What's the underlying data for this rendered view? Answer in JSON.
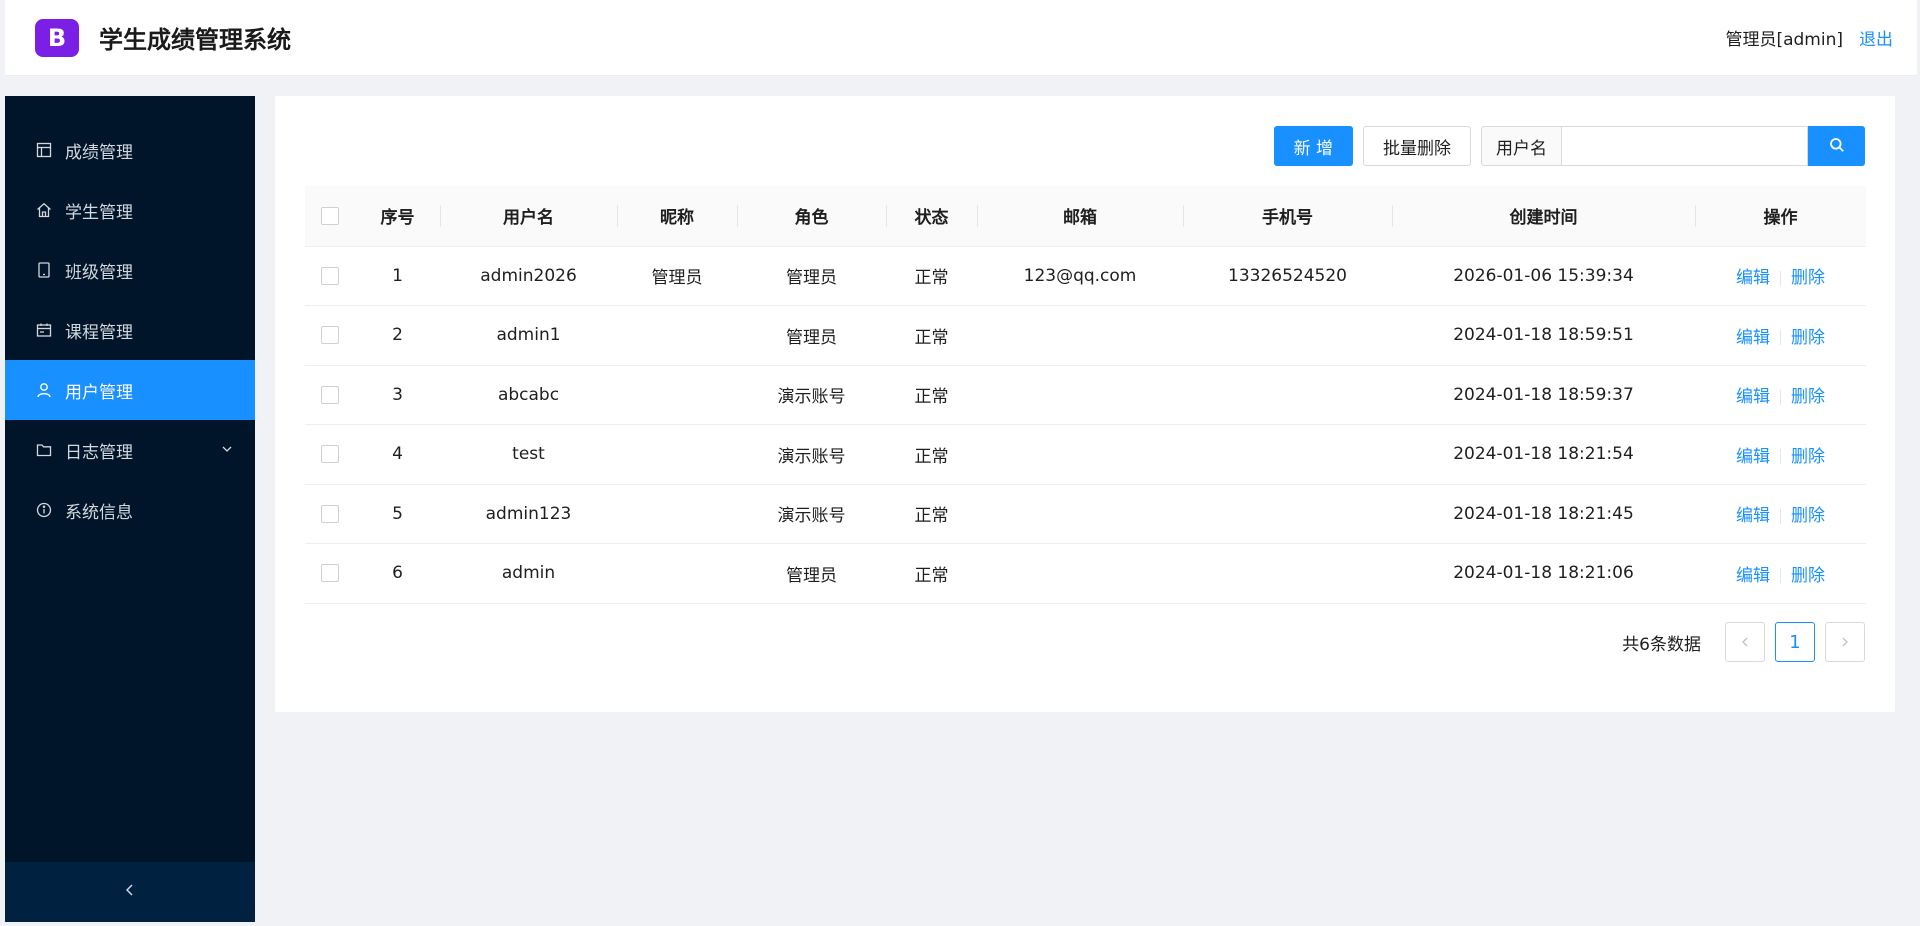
{
  "app": {
    "logo_letter": "B",
    "title": "学生成绩管理系统",
    "user_label": "管理员[admin]",
    "logout_label": "退出"
  },
  "sidebar": {
    "items": [
      {
        "label": "成绩管理",
        "icon": "layout-icon"
      },
      {
        "label": "学生管理",
        "icon": "home-icon"
      },
      {
        "label": "班级管理",
        "icon": "tablet-icon"
      },
      {
        "label": "课程管理",
        "icon": "schedule-icon"
      },
      {
        "label": "用户管理",
        "icon": "user-icon",
        "active": true
      },
      {
        "label": "日志管理",
        "icon": "folder-icon",
        "expandable": true
      },
      {
        "label": "系统信息",
        "icon": "info-icon"
      }
    ],
    "collapse_icon": "chevron-left-icon"
  },
  "toolbar": {
    "add_label": "新 增",
    "batch_delete_label": "批量删除",
    "search_addon": "用户名",
    "search_value": "",
    "search_icon": "search-icon"
  },
  "table": {
    "columns": [
      "序号",
      "用户名",
      "昵称",
      "角色",
      "状态",
      "邮箱",
      "手机号",
      "创建时间",
      "操作"
    ],
    "rows": [
      {
        "index": "1",
        "username": "admin2026",
        "nickname": "管理员",
        "role": "管理员",
        "status": "正常",
        "email": "123@qq.com",
        "phone": "13326524520",
        "created": "2026-01-06 15:39:34"
      },
      {
        "index": "2",
        "username": "admin1",
        "nickname": "",
        "role": "管理员",
        "status": "正常",
        "email": "",
        "phone": "",
        "created": "2024-01-18 18:59:51"
      },
      {
        "index": "3",
        "username": "abcabc",
        "nickname": "",
        "role": "演示账号",
        "status": "正常",
        "email": "",
        "phone": "",
        "created": "2024-01-18 18:59:37"
      },
      {
        "index": "4",
        "username": "test",
        "nickname": "",
        "role": "演示账号",
        "status": "正常",
        "email": "",
        "phone": "",
        "created": "2024-01-18 18:21:54"
      },
      {
        "index": "5",
        "username": "admin123",
        "nickname": "",
        "role": "演示账号",
        "status": "正常",
        "email": "",
        "phone": "",
        "created": "2024-01-18 18:21:45"
      },
      {
        "index": "6",
        "username": "admin",
        "nickname": "",
        "role": "管理员",
        "status": "正常",
        "email": "",
        "phone": "",
        "created": "2024-01-18 18:21:06"
      }
    ],
    "edit_label": "编辑",
    "delete_label": "删除"
  },
  "pagination": {
    "total_text": "共6条数据",
    "current_page": "1"
  },
  "colors": {
    "accent": "#1890ff",
    "sidebar_bg": "#001529",
    "logo_bg": "#7b1fe6"
  }
}
